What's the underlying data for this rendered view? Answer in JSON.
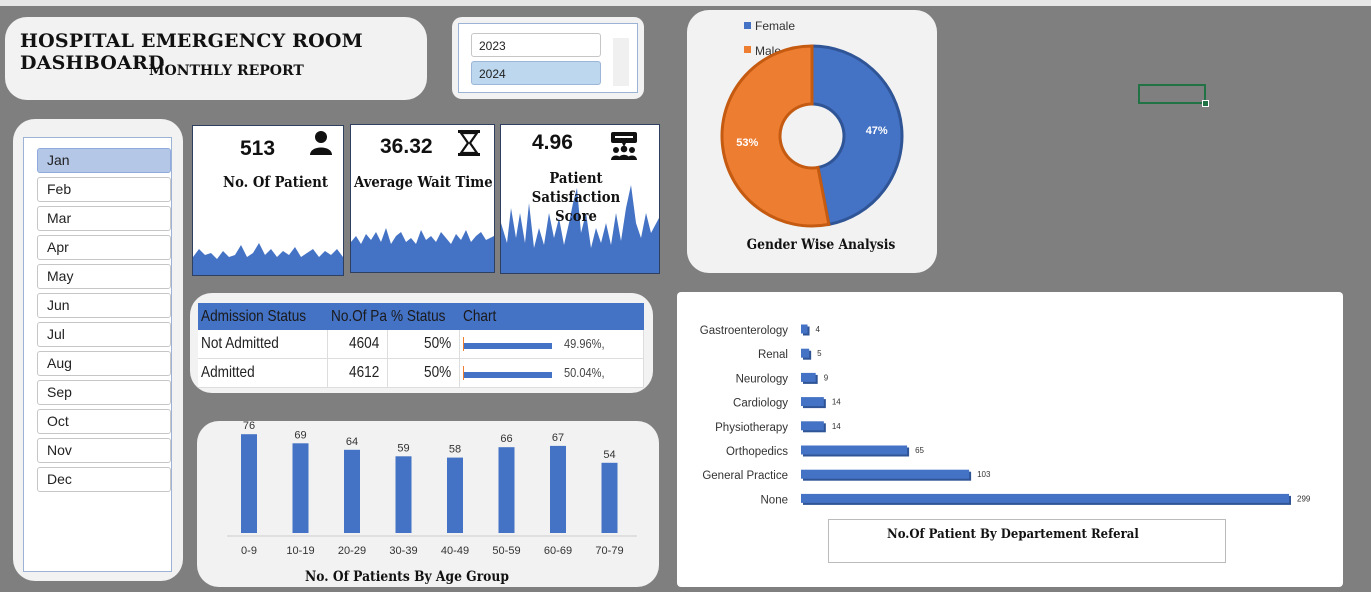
{
  "header": {
    "title": "HOSPITAL EMERGENCY ROOM DASHBOARD",
    "subtitle": "MONTHLY REPORT"
  },
  "year_slicer": {
    "options": [
      "2023",
      "2024"
    ],
    "selected": "2024"
  },
  "month_slicer": {
    "options": [
      "Jan",
      "Feb",
      "Mar",
      "Apr",
      "May",
      "Jun",
      "Jul",
      "Aug",
      "Sep",
      "Oct",
      "Nov",
      "Dec"
    ],
    "selected": "Jan"
  },
  "kpis": {
    "patients": {
      "value": "513",
      "label": "No. Of Patient",
      "icon": "person-icon"
    },
    "wait_time": {
      "value": "36.32",
      "label": "Average Wait Time",
      "icon": "hourglass-icon"
    },
    "satisfaction": {
      "value": "4.96",
      "label": "Patient Satisfaction Score",
      "icon": "group-feedback-icon"
    }
  },
  "gender": {
    "title": "Gender Wise Analysis",
    "legend": [
      "Female",
      "Male"
    ],
    "colors": {
      "Female": "#4472c4",
      "Male": "#ed7d31"
    },
    "chart_data": {
      "type": "pie",
      "labels": [
        "Female",
        "Male"
      ],
      "values": [
        47,
        53
      ],
      "display": [
        "47%",
        "53%"
      ]
    }
  },
  "admission": {
    "headers": [
      "Admission Status",
      "No.Of Pa",
      "% Status",
      "Chart"
    ],
    "rows": [
      {
        "status": "Not Admitted",
        "count": "4604",
        "pct": "50%",
        "chart_label": "49.96%,",
        "fraction": 0.4996
      },
      {
        "status": "Admitted",
        "count": "4612",
        "pct": "50%",
        "chart_label": "50.04%,",
        "fraction": 0.5004
      }
    ]
  },
  "age_chart": {
    "title": "No. Of Patients By Age Group",
    "chart_data": {
      "type": "bar",
      "categories": [
        "0-9",
        "10-19",
        "20-29",
        "30-39",
        "40-49",
        "50-59",
        "60-69",
        "70-79"
      ],
      "values": [
        76,
        69,
        64,
        59,
        58,
        66,
        67,
        54
      ],
      "ylim": [
        0,
        80
      ]
    }
  },
  "dept_chart": {
    "title": "No.Of Patient By Departement Referal",
    "chart_data": {
      "type": "bar",
      "orientation": "horizontal",
      "categories": [
        "Gastroenterology",
        "Renal",
        "Neurology",
        "Cardiology",
        "Physiotherapy",
        "Orthopedics",
        "General Practice",
        "None"
      ],
      "values": [
        4,
        5,
        9,
        14,
        14,
        65,
        103,
        299
      ]
    }
  },
  "colors": {
    "accent": "#4472c4",
    "orange": "#ed7d31",
    "background": "#7f7f7f"
  }
}
